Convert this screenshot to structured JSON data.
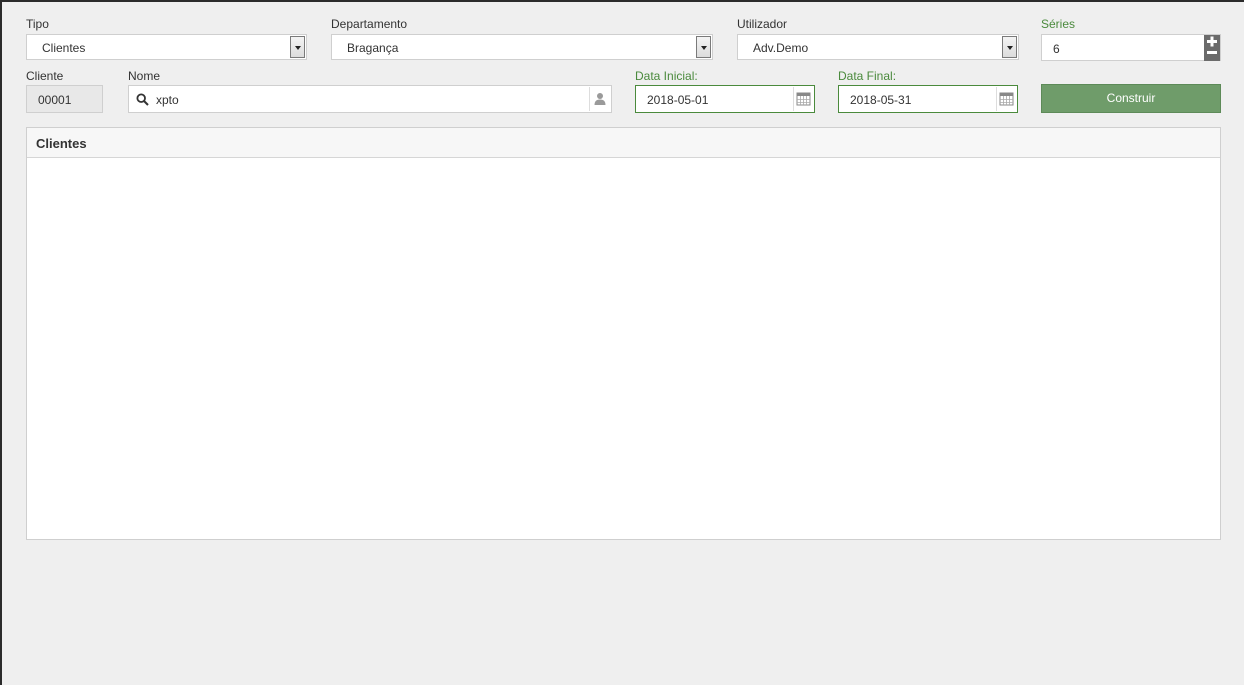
{
  "filters": {
    "tipo": {
      "label": "Tipo",
      "value": "Clientes"
    },
    "departamento": {
      "label": "Departamento",
      "value": "Bragança"
    },
    "utilizador": {
      "label": "Utilizador",
      "value": "Adv.Demo"
    },
    "series": {
      "label": "Séries",
      "value": "6"
    },
    "cliente": {
      "label": "Cliente",
      "value": "00001"
    },
    "nome": {
      "label": "Nome",
      "value": "xpto"
    },
    "data_inicial": {
      "label": "Data Inicial:",
      "value": "2018-05-01"
    },
    "data_final": {
      "label": "Data Final:",
      "value": "2018-05-31"
    }
  },
  "actions": {
    "build_label": "Construir"
  },
  "panel": {
    "title": "Clientes"
  },
  "colors": {
    "accent": "#4a8a3c",
    "button": "#6f9c6a"
  }
}
